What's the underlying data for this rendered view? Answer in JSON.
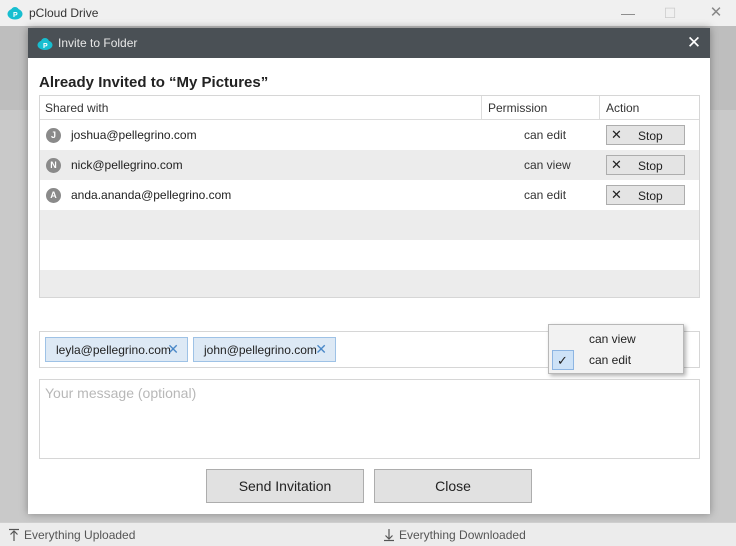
{
  "app": {
    "title": "pCloud Drive",
    "brand_color": "#17bed0"
  },
  "window_controls": {
    "minimize": "—",
    "maximize": "☐",
    "close": "✕"
  },
  "dialog": {
    "title": "Invite to Folder",
    "close_glyph": "✕",
    "heading": "Already Invited to “My Pictures”"
  },
  "table": {
    "headers": {
      "shared_with": "Shared with",
      "permission": "Permission",
      "action": "Action"
    },
    "rows": [
      {
        "initial": "J",
        "email": "joshua@pellegrino.com",
        "permission": "can edit",
        "action": "Stop"
      },
      {
        "initial": "N",
        "email": "nick@pellegrino.com",
        "permission": "can view",
        "action": "Stop"
      },
      {
        "initial": "A",
        "email": "anda.ananda@pellegrino.com",
        "permission": "can edit",
        "action": "Stop"
      }
    ]
  },
  "recipients": [
    {
      "email": "leyla@pellegrino.com",
      "remove": "✕"
    },
    {
      "email": "john@pellegrino.com",
      "remove": "✕"
    }
  ],
  "permission_menu": {
    "options": [
      "can view",
      "can edit"
    ],
    "selected": "can edit",
    "check": "✓"
  },
  "message": {
    "placeholder": "Your message (optional)",
    "value": ""
  },
  "buttons": {
    "send": "Send Invitation",
    "close": "Close"
  },
  "status": {
    "uploaded": "Everything Uploaded",
    "downloaded": "Everything Downloaded"
  }
}
